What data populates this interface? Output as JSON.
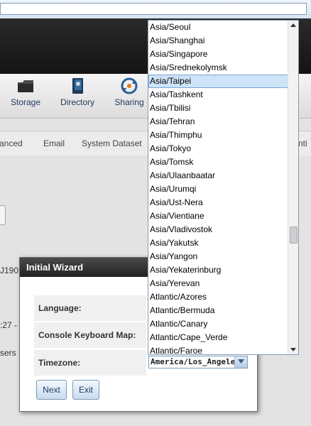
{
  "nav": {
    "storage_label": "Storage",
    "directory_label": "Directory",
    "sharing_label": "Sharing"
  },
  "tabs": {
    "advanced_partial": "anced",
    "email": "Email",
    "system_dataset": "System Dataset",
    "right_partial": "nti"
  },
  "background_fragments": {
    "frag1": "J190",
    "frag2": ":27 -",
    "frag3": "sers"
  },
  "wizard": {
    "title": "Initial Wizard",
    "language_label": "Language:",
    "keyboard_label": "Console Keyboard Map:",
    "timezone_label": "Timezone:",
    "timezone_value": "America/Los_Angeles",
    "next_button": "Next",
    "exit_button": "Exit"
  },
  "timezone_dropdown": {
    "selected": "Asia/Taipei",
    "options": [
      "Asia/Seoul",
      "Asia/Shanghai",
      "Asia/Singapore",
      "Asia/Srednekolymsk",
      "Asia/Taipei",
      "Asia/Tashkent",
      "Asia/Tbilisi",
      "Asia/Tehran",
      "Asia/Thimphu",
      "Asia/Tokyo",
      "Asia/Tomsk",
      "Asia/Ulaanbaatar",
      "Asia/Urumqi",
      "Asia/Ust-Nera",
      "Asia/Vientiane",
      "Asia/Vladivostok",
      "Asia/Yakutsk",
      "Asia/Yangon",
      "Asia/Yekaterinburg",
      "Asia/Yerevan",
      "Atlantic/Azores",
      "Atlantic/Bermuda",
      "Atlantic/Canary",
      "Atlantic/Cape_Verde",
      "Atlantic/Faroe"
    ]
  },
  "colors": {
    "selection_bg": "#cde3f7",
    "header_dark": "#1c1c1c",
    "link_blue": "#1e3a5a"
  }
}
